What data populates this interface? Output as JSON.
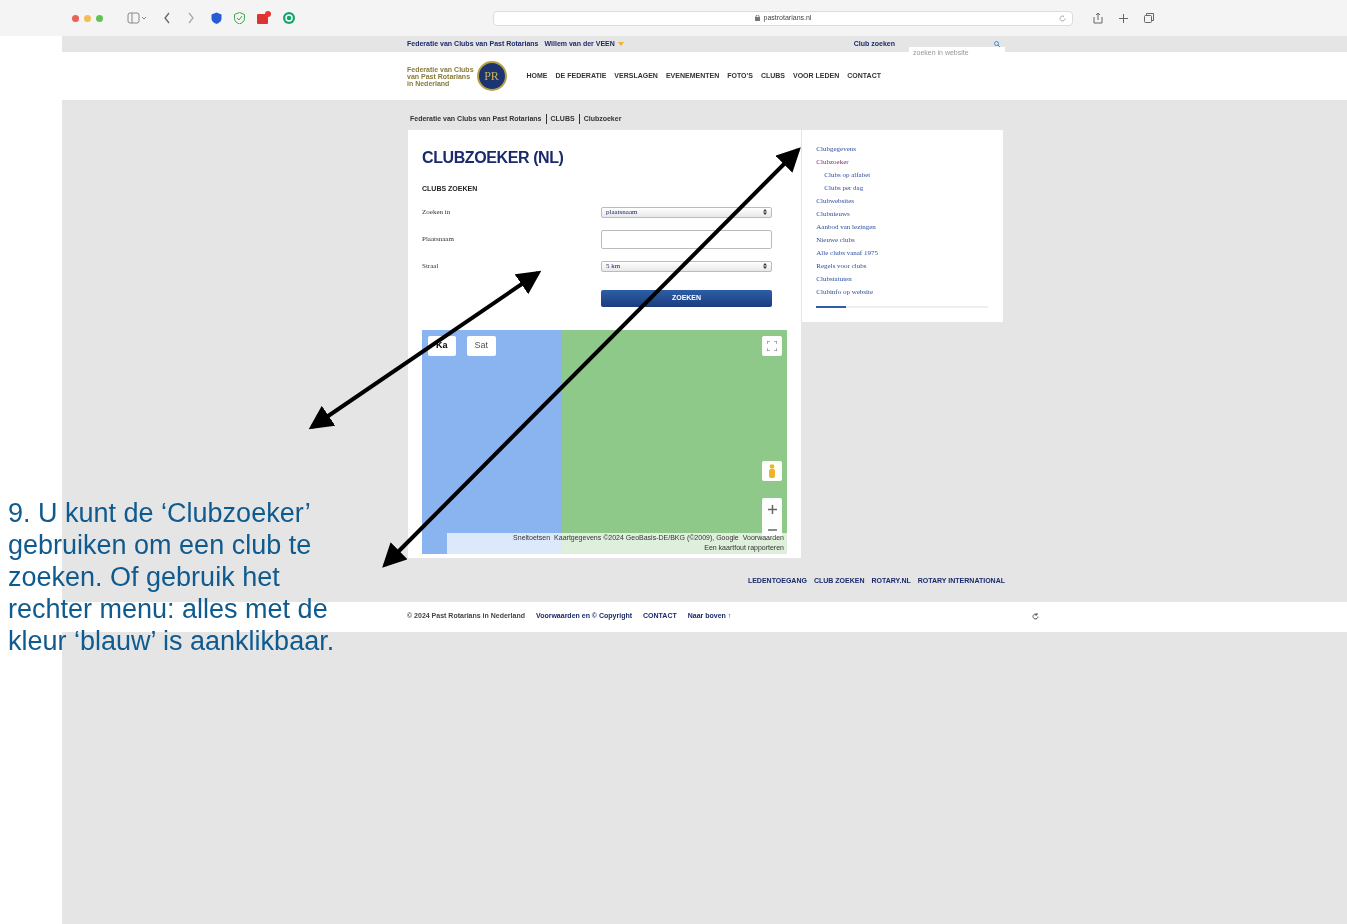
{
  "browser": {
    "url": "pastrotarians.nl"
  },
  "top_bar": {
    "site_link": "Federatie van Clubs van Past Rotarians",
    "user_name": "Willem van der VEEN",
    "club_search_link": "Club zoeken",
    "search_placeholder": "zoeken in website"
  },
  "logo": {
    "lines": [
      "Federatie van Clubs",
      "van Past Rotarians",
      "in Nederland"
    ],
    "letters": "PR"
  },
  "nav": [
    "HOME",
    "DE FEDERATIE",
    "VERSLAGEN",
    "EVENEMENTEN",
    "FOTO'S",
    "CLUBS",
    "VOOR LEDEN",
    "CONTACT"
  ],
  "breadcrumb": [
    "Federatie van Clubs van Past Rotarians",
    "CLUBS",
    "Clubzoeker"
  ],
  "page_title": "CLUBZOEKER (NL)",
  "section_title": "CLUBS ZOEKEN",
  "fields": [
    {
      "label": "Zoeken in",
      "kind": "select",
      "value": "plaatsnaam"
    },
    {
      "label": "Plaatsnaam",
      "kind": "text"
    },
    {
      "label": "Straal",
      "kind": "select",
      "value": "5 km"
    }
  ],
  "submit": "ZOEKEN",
  "map": {
    "type_buttons": [
      "Ka",
      "Sat"
    ],
    "attribution": [
      "Sneltoetsen",
      "Kaartgegevens ©2024 GeoBasis-DE/BKG (©2009), Google",
      "Voorwaarden",
      "Een kaartfout rapporteren"
    ]
  },
  "sidebar": {
    "items": [
      {
        "label": "Clubgegevens",
        "selected": false
      },
      {
        "label": "Clubzoeker",
        "selected": true,
        "children": [
          {
            "label": "Clubs op alfabet",
            "selected": false
          },
          {
            "label": "Clubs per dag",
            "selected": false
          }
        ]
      },
      {
        "label": "Clubwebsites",
        "selected": false
      },
      {
        "label": "Clubnieuws",
        "selected": false
      },
      {
        "label": "Aanbod van lezingen",
        "selected": false
      },
      {
        "label": "Nieuwe clubs",
        "selected": false
      },
      {
        "label": "Alle clubs vanaf 1975",
        "selected": false
      },
      {
        "label": "Regels voor clubs",
        "selected": false
      },
      {
        "label": "Clubstatuten",
        "selected": false
      },
      {
        "label": "Clubinfo op website",
        "selected": false
      }
    ],
    "level": 0.17
  },
  "footer_links": [
    "LEDENTOEGANG",
    "CLUB ZOEKEN",
    "ROTARY.NL",
    "ROTARY INTERNATIONAL"
  ],
  "footer": {
    "copyright": "© 2024 Past Rotarians in Nederland",
    "links": [
      "Voorwaarden en © Copyright",
      "CONTACT",
      "Naar boven ↑"
    ]
  },
  "annotation": "9. U kunt de ‘Clubzoeker’ gebruiken om een club te zoeken. Of gebruik het rechter menu: alles met de kleur ‘blauw’ is aanklikbaar."
}
